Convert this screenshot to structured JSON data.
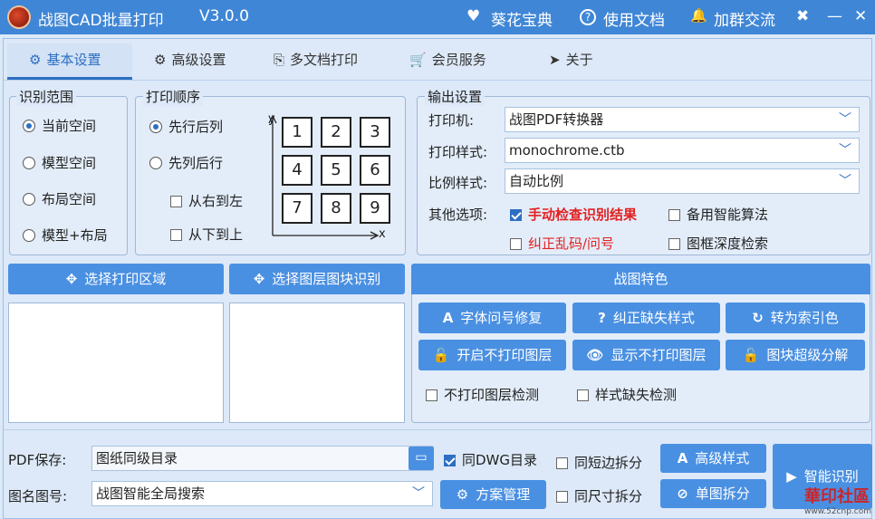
{
  "window": {
    "title": "战图CAD批量打印",
    "version": "V3.0.0",
    "links": [
      {
        "icon": "heart-icon",
        "glyph": "♥",
        "label": "葵花宝典"
      },
      {
        "icon": "help-icon",
        "glyph": "?",
        "label": "使用文档"
      },
      {
        "icon": "bell-icon",
        "glyph": "🔔",
        "label": "加群交流"
      }
    ],
    "controls": {
      "tools": "✖",
      "minimize": "—",
      "close": "✕"
    }
  },
  "tabs": [
    {
      "label": "基本设置",
      "glyph": "⚙"
    },
    {
      "label": "高级设置",
      "glyph": "⚙"
    },
    {
      "label": "多文档打印",
      "glyph": "⎘"
    },
    {
      "label": "会员服务",
      "glyph": "🛒"
    },
    {
      "label": "关于",
      "glyph": "➤"
    }
  ],
  "scope": {
    "legend": "识别范围",
    "options": [
      "当前空间",
      "模型空间",
      "布局空间",
      "模型+布局"
    ],
    "selected": "当前空间"
  },
  "order": {
    "legend": "打印顺序",
    "options": [
      "先行后列",
      "先列后行"
    ],
    "selected": "先行后列",
    "checks": [
      "从右到左",
      "从下到上"
    ],
    "grid": [
      "1",
      "2",
      "3",
      "4",
      "5",
      "6",
      "7",
      "8",
      "9"
    ],
    "axis_x": "x",
    "axis_y": "y"
  },
  "output": {
    "legend": "输出设置",
    "printer_label": "打印机:",
    "printer_value": "战图PDF转换器",
    "style_label": "打印样式:",
    "style_value": "monochrome.ctb",
    "scale_label": "比例样式:",
    "scale_value": "自动比例",
    "other_label": "其他选项:",
    "opt_manual_check": "手动检查识别结果",
    "opt_backup_algo": "备用智能算法",
    "opt_fix_garble": "纠正乱码/问号",
    "opt_deep_search": "图框深度检索"
  },
  "select_print_area": "选择打印区域",
  "select_layer_block": "选择图层图块识别",
  "features": {
    "header": "战图特色",
    "buttons": [
      {
        "glyph": "A",
        "label": "字体问号修复"
      },
      {
        "glyph": "?",
        "label": "纠正缺失样式"
      },
      {
        "glyph": "↻",
        "label": "转为索引色"
      },
      {
        "glyph": "🔓",
        "label": "开启不打印图层"
      },
      {
        "glyph": "👁",
        "label": "显示不打印图层"
      },
      {
        "glyph": "🔓",
        "label": "图块超级分解"
      }
    ],
    "check_noprint": "不打印图层检测",
    "check_style_missing": "样式缺失检测"
  },
  "bottom": {
    "pdf_label": "PDF保存:",
    "pdf_value": "图纸同级目录",
    "name_label": "图名图号:",
    "name_value": "战图智能全局搜索",
    "check_same_dwg": "同DWG目录",
    "check_short_split": "同短边拆分",
    "check_same_size": "同尺寸拆分",
    "scheme_btn": "方案管理",
    "adv_style_btn": "高级样式",
    "single_split_btn": "单图拆分",
    "smart_btn": "智能识别"
  },
  "watermark": {
    "text": "華印社區",
    "sub": "www.52cnp.com"
  },
  "colors": {
    "accent": "#2d6fc3",
    "button": "#4a90e2",
    "titlebar": "#3f86d6",
    "warning": "#e32121"
  }
}
